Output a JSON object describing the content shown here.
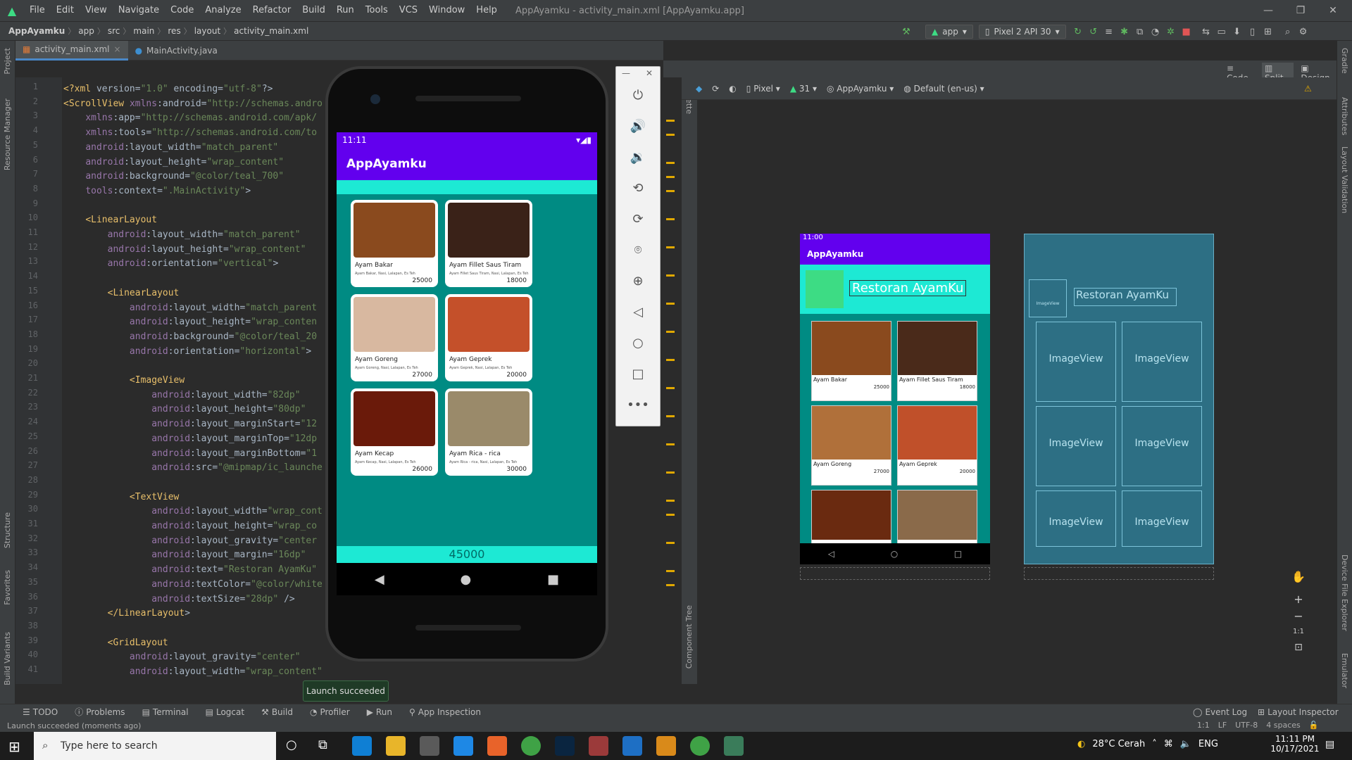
{
  "window": {
    "title": "AppAyamku - activity_main.xml [AppAyamku.app]",
    "menu": [
      "File",
      "Edit",
      "View",
      "Navigate",
      "Code",
      "Analyze",
      "Refactor",
      "Build",
      "Run",
      "Tools",
      "VCS",
      "Window",
      "Help"
    ]
  },
  "breadcrumbs": [
    "AppAyamku",
    "app",
    "src",
    "main",
    "res",
    "layout",
    "activity_main.xml"
  ],
  "toolbar": {
    "run_config": "app",
    "device": "Pixel 2 API 30"
  },
  "tabs": [
    {
      "label": "activity_main.xml"
    },
    {
      "label": "MainActivity.java"
    }
  ],
  "left_strip": [
    "Project",
    "Resource Manager",
    "Structure",
    "Favorites",
    "Build Variants"
  ],
  "right_strip": [
    "Gradle",
    "Attributes",
    "Layout Validation",
    "Device File Explorer",
    "Emulator"
  ],
  "editor": {
    "line_numbers": [
      "1",
      "2",
      "3",
      "4",
      "5",
      "6",
      "7",
      "8",
      "9",
      "10",
      "11",
      "12",
      "13",
      "14",
      "15",
      "16",
      "17",
      "18",
      "19",
      "20",
      "21",
      "22",
      "23",
      "24",
      "25",
      "26",
      "27",
      "28",
      "29",
      "30",
      "31",
      "32",
      "33",
      "34",
      "35",
      "36",
      "37",
      "38",
      "39",
      "40",
      "41"
    ],
    "lines": [
      "<?xml version=\"1.0\" encoding=\"utf-8\"?>",
      "<ScrollView xmlns:android=\"http://schemas.andro",
      "    xmlns:app=\"http://schemas.android.com/apk/",
      "    xmlns:tools=\"http://schemas.android.com/to",
      "    android:layout_width=\"match_parent\"",
      "    android:layout_height=\"wrap_content\"",
      "    android:background=\"@color/teal_700\"",
      "    tools:context=\".MainActivity\">",
      "",
      "    <LinearLayout",
      "        android:layout_width=\"match_parent\"",
      "        android:layout_height=\"wrap_content\"",
      "        android:orientation=\"vertical\">",
      "",
      "        <LinearLayout",
      "            android:layout_width=\"match_parent",
      "            android:layout_height=\"wrap_conten",
      "            android:background=\"@color/teal_20",
      "            android:orientation=\"horizontal\">",
      "",
      "            <ImageView",
      "                android:layout_width=\"82dp\"",
      "                android:layout_height=\"80dp\"",
      "                android:layout_marginStart=\"12",
      "                android:layout_marginTop=\"12dp",
      "                android:layout_marginBottom=\"1",
      "                android:src=\"@mipmap/ic_launche",
      "",
      "            <TextView",
      "                android:layout_width=\"wrap_cont",
      "                android:layout_height=\"wrap_co",
      "                android:layout_gravity=\"center",
      "                android:layout_margin=\"16dp\"",
      "                android:text=\"Restoran AyamKu\"",
      "                android:textColor=\"@color/white",
      "                android:textSize=\"28dp\" />",
      "        </LinearLayout>",
      "",
      "        <GridLayout",
      "            android:layout_gravity=\"center\"",
      "            android:layout_width=\"wrap_content\""
    ]
  },
  "emulator": {
    "time": "11:11",
    "app_title": "AppAyamku",
    "total": "45000",
    "menu": [
      {
        "name": "Ayam Bakar",
        "desc": "Ayam Bakar, Nasi, Lalapan, Es Teh",
        "price": "25000"
      },
      {
        "name": "Ayam Fillet Saus Tiram",
        "desc": "Ayam Fillet Saus Tiram, Nasi, Lalapan, Es Teh",
        "price": "18000"
      },
      {
        "name": "Ayam Goreng",
        "desc": "Ayam Goreng, Nasi, Lalapan, Es Teh",
        "price": "27000"
      },
      {
        "name": "Ayam Geprek",
        "desc": "Ayam Geprek, Nasi, Lalapan, Es Teh",
        "price": "20000"
      },
      {
        "name": "Ayam Kecap",
        "desc": "Ayam Kecap, Nasi, Lalapan, Es Teh",
        "price": "26000"
      },
      {
        "name": "Ayam Rica - rica",
        "desc": "Ayam Rica - rica, Nasi, Lalapan, Es Teh",
        "price": "30000"
      }
    ]
  },
  "design": {
    "view_modes": [
      "Code",
      "Split",
      "Design"
    ],
    "device": "Pixel",
    "api": "31",
    "theme": "AppAyamku",
    "locale": "Default (en-us)",
    "palette_label": "Palette",
    "component_tree_label": "Component Tree",
    "preview_time": "11:00",
    "preview_app_title": "AppAyamku",
    "preview_header": "Restoran AyamKu",
    "preview_prices": [
      "25000",
      "18000",
      "27000",
      "20000"
    ],
    "preview_names": [
      "Ayam Bakar",
      "Ayam Fillet Saus Tiram",
      "Ayam Goreng",
      "Ayam Geprek"
    ],
    "blueprint_imageview": "ImageView",
    "blueprint_small_iv": "ImageView",
    "zoom_fit": "1:1"
  },
  "toast": "Launch succeeded",
  "bottom_tools": [
    "TODO",
    "Problems",
    "Terminal",
    "Logcat",
    "Build",
    "Profiler",
    "Run",
    "App Inspection"
  ],
  "bottom_right_tools": [
    "Event Log",
    "Layout Inspector"
  ],
  "status": {
    "message": "Launch succeeded (moments ago)",
    "position": "1:1",
    "line_sep": "LF",
    "encoding": "UTF-8",
    "indent": "4 spaces"
  },
  "taskbar": {
    "search_placeholder": "Type here to search",
    "weather": "28°C  Cerah",
    "lang": "ENG",
    "time": "11:11 PM",
    "date": "10/17/2021"
  },
  "colors": {
    "purple": "#6200ee",
    "teal_700": "#008b83",
    "teal_200": "#1de9d4"
  }
}
